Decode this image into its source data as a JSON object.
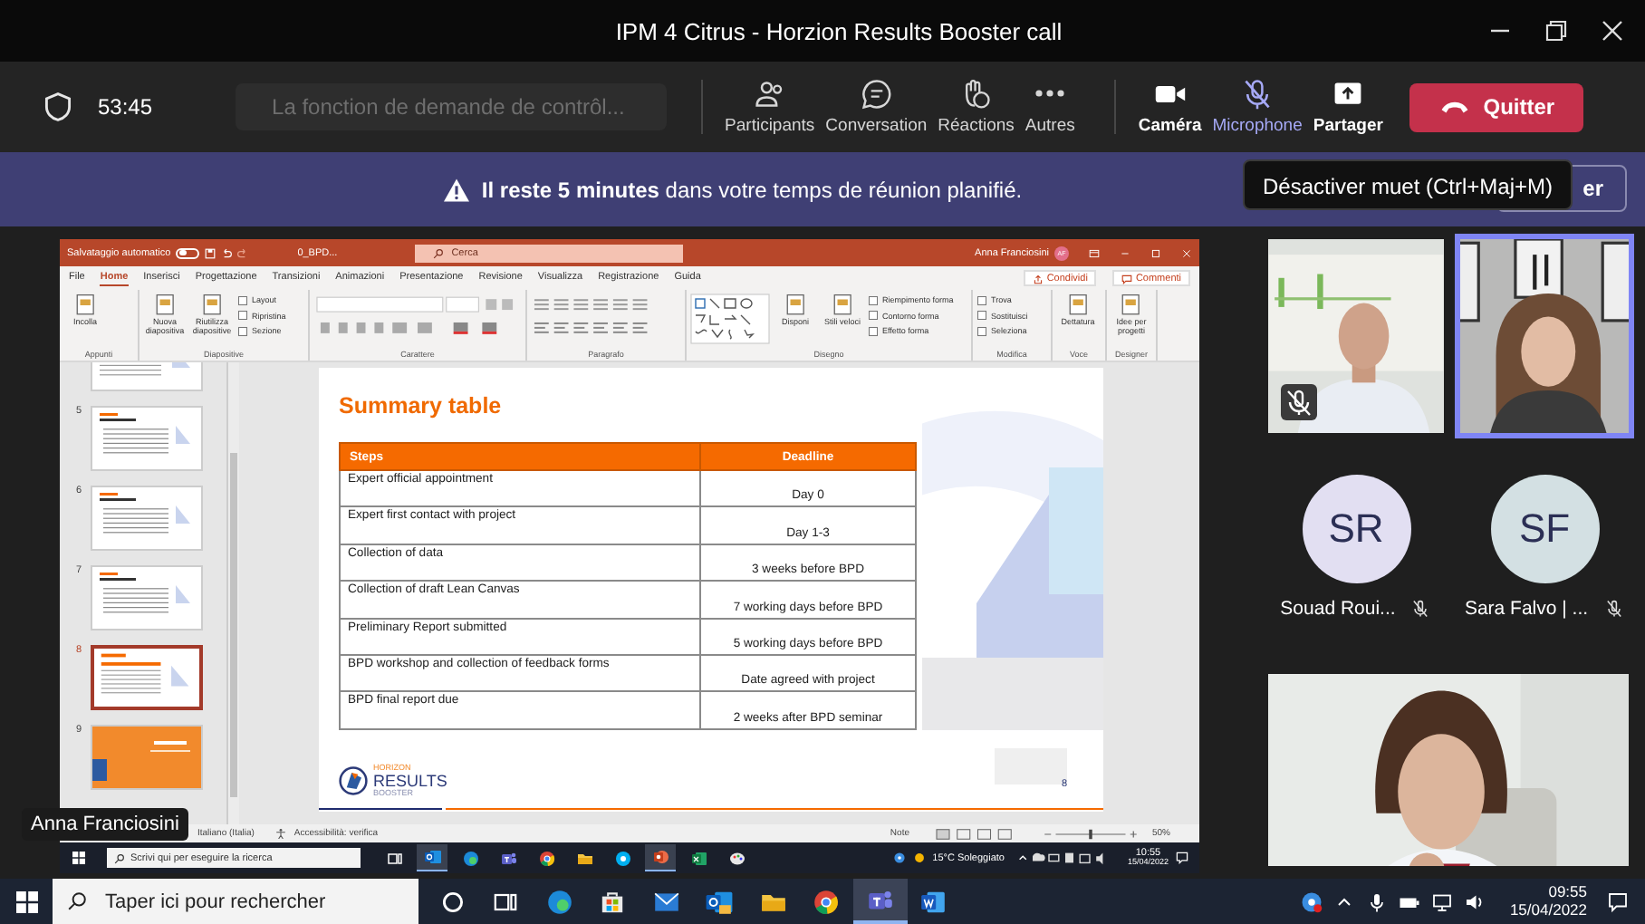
{
  "window": {
    "title": "IPM 4 Citrus - Horzion Results Booster call"
  },
  "meeting_bar": {
    "timer": "53:45",
    "status": "La fonction de demande de contrôl...",
    "meeting_actions": [
      {
        "kind": "participants",
        "label": "Participants",
        "highlighted": false
      },
      {
        "kind": "chat",
        "label": "Conversation",
        "highlighted": false
      },
      {
        "kind": "reactions",
        "label": "Réactions",
        "highlighted": false
      },
      {
        "kind": "more",
        "label": "Autres",
        "highlighted": false
      }
    ],
    "device_actions": [
      {
        "kind": "camera",
        "label": "Caméra",
        "highlighted": false
      },
      {
        "kind": "microphone",
        "label": "Microphone",
        "highlighted": true
      },
      {
        "kind": "share",
        "label": "Partager",
        "highlighted": false
      }
    ],
    "leave_button": "Quitter"
  },
  "banner": {
    "message": "**Il reste 5 minutes** dans votre temps de réunion planifié.",
    "button": "er"
  },
  "tooltip": "Désactiver muet (Ctrl+Maj+M)",
  "shared_screen": {
    "presenter": "Anna Franciosini",
    "app": {
      "autosave_label": "Salvataggio automatico",
      "autosave_on": false,
      "file_name": "0_BPD...",
      "search": {
        "placeholder": "Cerca"
      },
      "user": "Anna Franciosini",
      "user_initials": "AF",
      "tabs": [
        {
          "label": "File",
          "selected": false
        },
        {
          "label": "Home",
          "selected": true
        },
        {
          "label": "Inserisci",
          "selected": false
        },
        {
          "label": "Progettazione",
          "selected": false
        },
        {
          "label": "Transizioni",
          "selected": false
        },
        {
          "label": "Animazioni",
          "selected": false
        },
        {
          "label": "Presentazione",
          "selected": false
        },
        {
          "label": "Revisione",
          "selected": false
        },
        {
          "label": "Visualizza",
          "selected": false
        },
        {
          "label": "Registrazione",
          "selected": false
        },
        {
          "label": "Guida",
          "selected": false
        }
      ],
      "share_button": "Condividi",
      "comments_button": "Commenti",
      "ribbon_groups": [
        {
          "label": "Appunti",
          "kind": "commands",
          "items": [
            {
              "label": "Incolla",
              "kind": "large"
            }
          ]
        },
        {
          "label": "Diapositive",
          "kind": "commands",
          "items": [
            {
              "label": "Nuova diapositiva",
              "kind": "large"
            },
            {
              "label": "Riutilizza diapositive",
              "kind": "large"
            },
            {
              "label": "Layout",
              "kind": "small"
            },
            {
              "label": "Ripristina",
              "kind": "small"
            },
            {
              "label": "Sezione",
              "kind": "small"
            }
          ]
        },
        {
          "label": "Carattere",
          "kind": "font"
        },
        {
          "label": "Paragrafo",
          "kind": "paragraph"
        },
        {
          "label": "Disegno",
          "kind": "commands",
          "items": [
            {
              "kind": "gallery"
            },
            {
              "label": "Disponi",
              "kind": "large"
            },
            {
              "label": "Stili veloci",
              "kind": "large"
            },
            {
              "label": "Riempimento forma",
              "kind": "small"
            },
            {
              "label": "Contorno forma",
              "kind": "small"
            },
            {
              "label": "Effetto forma",
              "kind": "small"
            }
          ]
        },
        {
          "label": "Modifica",
          "kind": "commands",
          "items": [
            {
              "label": "Trova",
              "kind": "small"
            },
            {
              "label": "Sostituisci",
              "kind": "small"
            },
            {
              "label": "Seleziona",
              "kind": "small"
            }
          ]
        },
        {
          "label": "Voce",
          "kind": "commands",
          "items": [
            {
              "label": "Dettatura",
              "kind": "large"
            }
          ]
        },
        {
          "label": "Designer",
          "kind": "commands",
          "items": [
            {
              "label": "Idee per progetti",
              "kind": "large"
            }
          ]
        }
      ],
      "thumbnails": [
        {
          "kind": "table",
          "selected": false
        },
        {
          "number": "5",
          "kind": "text",
          "selected": false
        },
        {
          "number": "6",
          "kind": "text",
          "selected": false
        },
        {
          "number": "7",
          "kind": "text",
          "selected": false
        },
        {
          "number": "8",
          "kind": "table",
          "selected": true
        },
        {
          "number": "9",
          "kind": "cover",
          "selected": false
        }
      ],
      "slide": {
        "title": "Summary table",
        "columns": [
          "Steps",
          "Deadline"
        ],
        "rows": [
          [
            "Expert official appointment",
            "Day 0"
          ],
          [
            "Expert first contact with project",
            "Day 1-3"
          ],
          [
            "Collection of data",
            "3 weeks before BPD"
          ],
          [
            "Collection of draft Lean Canvas",
            "7 working days before BPD"
          ],
          [
            "Preliminary Report submitted",
            "5 working days before BPD"
          ],
          [
            "BPD workshop and collection of feedback forms",
            "Date agreed with project"
          ],
          [
            "BPD final report due",
            "2 weeks after BPD seminar"
          ]
        ],
        "logo": [
          "HORIZON",
          "RESULTS",
          "BOOSTER"
        ],
        "page_number": "8"
      },
      "status_bar": {
        "language": "Italiano (Italia)",
        "accessibility": "Accessibilità: verifica",
        "notes": "Note",
        "zoom_slider": {
          "level": 0.5
        },
        "zoom": "50%"
      }
    },
    "taskbar": {
      "search": {
        "placeholder": "Scrivi qui per eseguire la ricerca"
      },
      "apps": [
        {
          "kind": "taskview",
          "active": false
        },
        {
          "kind": "outlook",
          "active": true
        },
        {
          "kind": "edge",
          "active": false
        },
        {
          "kind": "teams",
          "active": false
        },
        {
          "kind": "chrome",
          "active": false
        },
        {
          "kind": "explorer",
          "active": false
        },
        {
          "kind": "skype",
          "active": false
        },
        {
          "kind": "powerpoint",
          "active": true
        },
        {
          "kind": "excel",
          "active": false
        },
        {
          "kind": "paint",
          "active": false
        }
      ],
      "weather": "15°C Soleggiato",
      "time": "10:55",
      "date": "15/04/2022"
    }
  },
  "participants": [
    {
      "kind": "video",
      "muted": true,
      "speaking": false
    },
    {
      "kind": "video",
      "muted": false,
      "speaking": true
    },
    {
      "kind": "avatar",
      "initials": "SR",
      "name": "Souad Roui...",
      "muted": true,
      "color": "#e2dff2"
    },
    {
      "kind": "avatar",
      "initials": "SF",
      "name": "Sara Falvo | ...",
      "muted": true,
      "color": "#d3e0e3"
    },
    {
      "kind": "video",
      "muted": false,
      "speaking": false
    }
  ],
  "taskbar": {
    "search": {
      "placeholder": "Taper ici pour rechercher"
    },
    "apps": [
      {
        "kind": "cortana",
        "active": false
      },
      {
        "kind": "taskview",
        "active": false
      },
      {
        "kind": "edge",
        "active": false
      },
      {
        "kind": "store",
        "active": false
      },
      {
        "kind": "mail",
        "active": false
      },
      {
        "kind": "outlook",
        "active": false
      },
      {
        "kind": "explorer",
        "active": false
      },
      {
        "kind": "chrome",
        "active": false
      },
      {
        "kind": "teams",
        "active": true
      },
      {
        "kind": "word",
        "active": false
      }
    ],
    "time": "09:55",
    "date": "15/04/2022"
  }
}
